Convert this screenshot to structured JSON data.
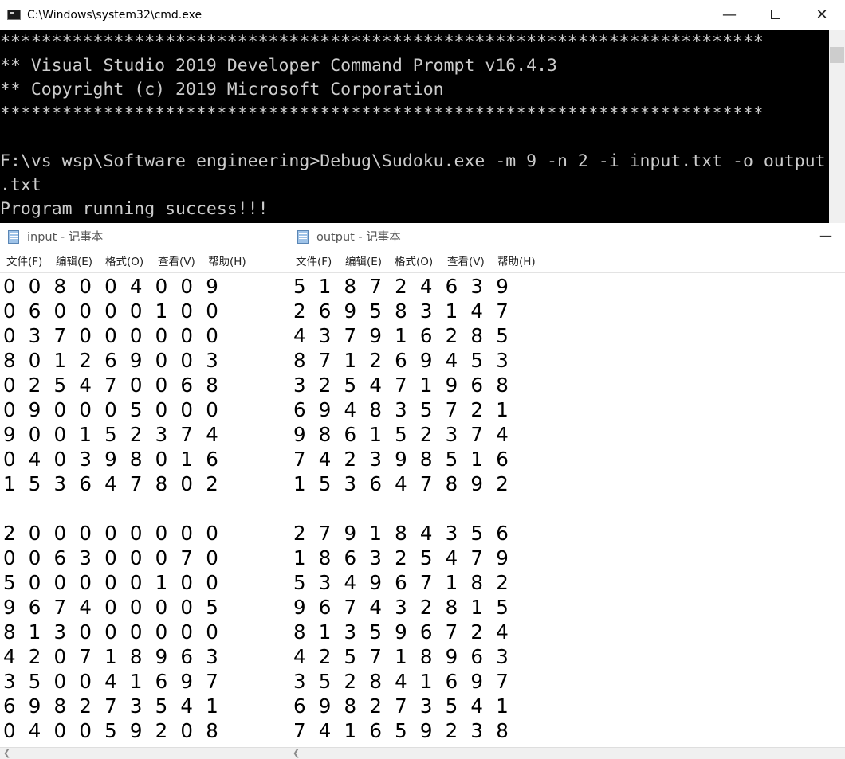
{
  "cmd": {
    "title": "C:\\Windows\\system32\\cmd.exe",
    "buttons": {
      "minimize": "—",
      "close": "✕"
    },
    "lines": [
      "**************************************************************************",
      "** Visual Studio 2019 Developer Command Prompt v16.4.3",
      "** Copyright (c) 2019 Microsoft Corporation",
      "**************************************************************************",
      "",
      "F:\\vs wsp\\Software engineering>Debug\\Sudoku.exe -m 9 -n 2 -i input.txt -o output",
      ".txt",
      "Program running success!!!"
    ]
  },
  "input_window": {
    "title": "input - 记事本",
    "menus": [
      "文件(F)",
      "编辑(E)",
      "格式(O)",
      "查看(V)",
      "帮助(H)"
    ],
    "lines": [
      "0 0 8 0 0 4 0 0 9",
      "0 6 0 0 0 0 1 0 0",
      "0 3 7 0 0 0 0 0 0",
      "8 0 1 2 6 9 0 0 3",
      "0 2 5 4 7 0 0 6 8",
      "0 9 0 0 0 5 0 0 0",
      "9 0 0 1 5 2 3 7 4",
      "0 4 0 3 9 8 0 1 6",
      "1 5 3 6 4 7 8 0 2",
      "",
      "2 0 0 0 0 0 0 0 0",
      "0 0 6 3 0 0 0 7 0",
      "5 0 0 0 0 0 1 0 0",
      "9 6 7 4 0 0 0 0 5",
      "8 1 3 0 0 0 0 0 0",
      "4 2 0 7 1 8 9 6 3",
      "3 5 0 0 4 1 6 9 7",
      "6 9 8 2 7 3 5 4 1",
      "0 4 0 0 5 9 2 0 8"
    ]
  },
  "output_window": {
    "title": "output - 记事本",
    "menus": [
      "文件(F)",
      "编辑(E)",
      "格式(O)",
      "查看(V)",
      "帮助(H)"
    ],
    "lines": [
      "5 1 8 7 2 4 6 3 9",
      "2 6 9 5 8 3 1 4 7",
      "4 3 7 9 1 6 2 8 5",
      "8 7 1 2 6 9 4 5 3",
      "3 2 5 4 7 1 9 6 8",
      "6 9 4 8 3 5 7 2 1",
      "9 8 6 1 5 2 3 7 4",
      "7 4 2 3 9 8 5 1 6",
      "1 5 3 6 4 7 8 9 2",
      "",
      "2 7 9 1 8 4 3 5 6",
      "1 8 6 3 2 5 4 7 9",
      "5 3 4 9 6 7 1 8 2",
      "9 6 7 4 3 2 8 1 5",
      "8 1 3 5 9 6 7 2 4",
      "4 2 5 7 1 8 9 6 3",
      "3 5 2 8 4 1 6 9 7",
      "6 9 8 2 7 3 5 4 1",
      "7 4 1 6 5 9 2 3 8"
    ]
  }
}
